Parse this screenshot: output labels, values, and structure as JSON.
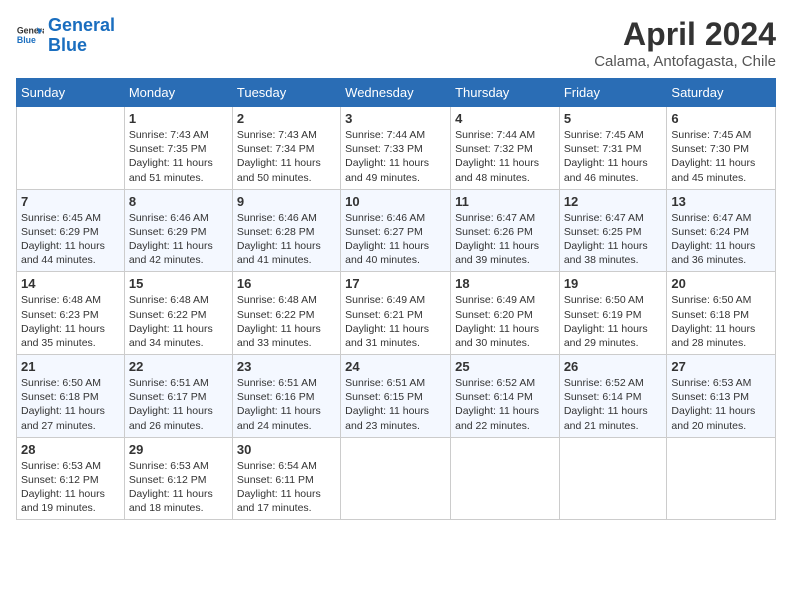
{
  "header": {
    "logo_line1": "General",
    "logo_line2": "Blue",
    "month": "April 2024",
    "location": "Calama, Antofagasta, Chile"
  },
  "days_of_week": [
    "Sunday",
    "Monday",
    "Tuesday",
    "Wednesday",
    "Thursday",
    "Friday",
    "Saturday"
  ],
  "weeks": [
    [
      {
        "day": "",
        "info": ""
      },
      {
        "day": "1",
        "info": "Sunrise: 7:43 AM\nSunset: 7:35 PM\nDaylight: 11 hours\nand 51 minutes."
      },
      {
        "day": "2",
        "info": "Sunrise: 7:43 AM\nSunset: 7:34 PM\nDaylight: 11 hours\nand 50 minutes."
      },
      {
        "day": "3",
        "info": "Sunrise: 7:44 AM\nSunset: 7:33 PM\nDaylight: 11 hours\nand 49 minutes."
      },
      {
        "day": "4",
        "info": "Sunrise: 7:44 AM\nSunset: 7:32 PM\nDaylight: 11 hours\nand 48 minutes."
      },
      {
        "day": "5",
        "info": "Sunrise: 7:45 AM\nSunset: 7:31 PM\nDaylight: 11 hours\nand 46 minutes."
      },
      {
        "day": "6",
        "info": "Sunrise: 7:45 AM\nSunset: 7:30 PM\nDaylight: 11 hours\nand 45 minutes."
      }
    ],
    [
      {
        "day": "7",
        "info": "Sunrise: 6:45 AM\nSunset: 6:29 PM\nDaylight: 11 hours\nand 44 minutes."
      },
      {
        "day": "8",
        "info": "Sunrise: 6:46 AM\nSunset: 6:29 PM\nDaylight: 11 hours\nand 42 minutes."
      },
      {
        "day": "9",
        "info": "Sunrise: 6:46 AM\nSunset: 6:28 PM\nDaylight: 11 hours\nand 41 minutes."
      },
      {
        "day": "10",
        "info": "Sunrise: 6:46 AM\nSunset: 6:27 PM\nDaylight: 11 hours\nand 40 minutes."
      },
      {
        "day": "11",
        "info": "Sunrise: 6:47 AM\nSunset: 6:26 PM\nDaylight: 11 hours\nand 39 minutes."
      },
      {
        "day": "12",
        "info": "Sunrise: 6:47 AM\nSunset: 6:25 PM\nDaylight: 11 hours\nand 38 minutes."
      },
      {
        "day": "13",
        "info": "Sunrise: 6:47 AM\nSunset: 6:24 PM\nDaylight: 11 hours\nand 36 minutes."
      }
    ],
    [
      {
        "day": "14",
        "info": "Sunrise: 6:48 AM\nSunset: 6:23 PM\nDaylight: 11 hours\nand 35 minutes."
      },
      {
        "day": "15",
        "info": "Sunrise: 6:48 AM\nSunset: 6:22 PM\nDaylight: 11 hours\nand 34 minutes."
      },
      {
        "day": "16",
        "info": "Sunrise: 6:48 AM\nSunset: 6:22 PM\nDaylight: 11 hours\nand 33 minutes."
      },
      {
        "day": "17",
        "info": "Sunrise: 6:49 AM\nSunset: 6:21 PM\nDaylight: 11 hours\nand 31 minutes."
      },
      {
        "day": "18",
        "info": "Sunrise: 6:49 AM\nSunset: 6:20 PM\nDaylight: 11 hours\nand 30 minutes."
      },
      {
        "day": "19",
        "info": "Sunrise: 6:50 AM\nSunset: 6:19 PM\nDaylight: 11 hours\nand 29 minutes."
      },
      {
        "day": "20",
        "info": "Sunrise: 6:50 AM\nSunset: 6:18 PM\nDaylight: 11 hours\nand 28 minutes."
      }
    ],
    [
      {
        "day": "21",
        "info": "Sunrise: 6:50 AM\nSunset: 6:18 PM\nDaylight: 11 hours\nand 27 minutes."
      },
      {
        "day": "22",
        "info": "Sunrise: 6:51 AM\nSunset: 6:17 PM\nDaylight: 11 hours\nand 26 minutes."
      },
      {
        "day": "23",
        "info": "Sunrise: 6:51 AM\nSunset: 6:16 PM\nDaylight: 11 hours\nand 24 minutes."
      },
      {
        "day": "24",
        "info": "Sunrise: 6:51 AM\nSunset: 6:15 PM\nDaylight: 11 hours\nand 23 minutes."
      },
      {
        "day": "25",
        "info": "Sunrise: 6:52 AM\nSunset: 6:14 PM\nDaylight: 11 hours\nand 22 minutes."
      },
      {
        "day": "26",
        "info": "Sunrise: 6:52 AM\nSunset: 6:14 PM\nDaylight: 11 hours\nand 21 minutes."
      },
      {
        "day": "27",
        "info": "Sunrise: 6:53 AM\nSunset: 6:13 PM\nDaylight: 11 hours\nand 20 minutes."
      }
    ],
    [
      {
        "day": "28",
        "info": "Sunrise: 6:53 AM\nSunset: 6:12 PM\nDaylight: 11 hours\nand 19 minutes."
      },
      {
        "day": "29",
        "info": "Sunrise: 6:53 AM\nSunset: 6:12 PM\nDaylight: 11 hours\nand 18 minutes."
      },
      {
        "day": "30",
        "info": "Sunrise: 6:54 AM\nSunset: 6:11 PM\nDaylight: 11 hours\nand 17 minutes."
      },
      {
        "day": "",
        "info": ""
      },
      {
        "day": "",
        "info": ""
      },
      {
        "day": "",
        "info": ""
      },
      {
        "day": "",
        "info": ""
      }
    ]
  ]
}
